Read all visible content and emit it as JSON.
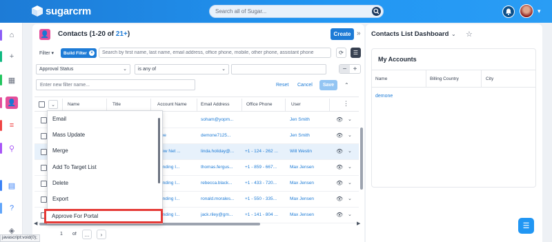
{
  "app": {
    "name": "sugarcrm"
  },
  "global_search": {
    "placeholder": "Search all of Sugar..."
  },
  "list": {
    "title_prefix": "Contacts (1-20 of ",
    "count": "21+",
    "title_suffix": ")",
    "create_label": "Create",
    "filter_label": "Filter",
    "build_filter_label": "Build Filter",
    "search_placeholder": "Search by first name, last name, email address, office phone, mobile, other phone, assistant phone",
    "filter_field": "Approval Status",
    "filter_operator": "is any of",
    "filter_name_placeholder": "Enter new filter name...",
    "reset_label": "Reset",
    "cancel_label": "Cancel",
    "save_label": "Save"
  },
  "table": {
    "columns": [
      "Name",
      "Title",
      "Account Name",
      "Email Address",
      "Office Phone",
      "User"
    ],
    "rows": [
      {
        "name": "",
        "title": "",
        "account": "",
        "email": "soham@yopm...",
        "phone": "",
        "user": "Jen Smith"
      },
      {
        "name": "",
        "title": "",
        "account": "rone",
        "email": "demone7125...",
        "phone": "",
        "user": "Jen Smith"
      },
      {
        "name": "",
        "title": "",
        "account": "lview Net ...",
        "email": "linda.holiday@...",
        "phone": "+1 - 124 - 262 ...",
        "user": "Will Westin"
      },
      {
        "name": "",
        "title": "",
        "account": "Funding I...",
        "email": "thomas.fergus...",
        "phone": "+1 - 859 - 667...",
        "user": "Max Jensen"
      },
      {
        "name": "",
        "title": "",
        "account": "Funding I...",
        "email": "rebecca.black...",
        "phone": "+1 - 433 - 720...",
        "user": "Max Jensen"
      },
      {
        "name": "",
        "title": "",
        "account": "Funding I...",
        "email": "ronald.morales...",
        "phone": "+1 - 550 - 335...",
        "user": "Max Jensen"
      },
      {
        "name": "",
        "title": "",
        "account": "Funding I...",
        "email": "jack.riley@gm...",
        "phone": "+1 - 141 - 804 ...",
        "user": "Max Jensen"
      }
    ]
  },
  "mass_actions": {
    "items": [
      "Email",
      "Mass Update",
      "Merge",
      "Add To Target List",
      "Delete",
      "Export"
    ],
    "highlighted": "Approve For Portal"
  },
  "pager": {
    "page": "1",
    "of_label": "of",
    "total": "..."
  },
  "status_bar": {
    "text": "javascript:void(0);"
  },
  "dashboard": {
    "title": "Contacts List Dashboard",
    "dashlet_title": "My Accounts",
    "columns": [
      "Name",
      "Billing Country",
      "City"
    ],
    "rows": [
      {
        "name": "demone",
        "country": "",
        "city": ""
      }
    ]
  }
}
